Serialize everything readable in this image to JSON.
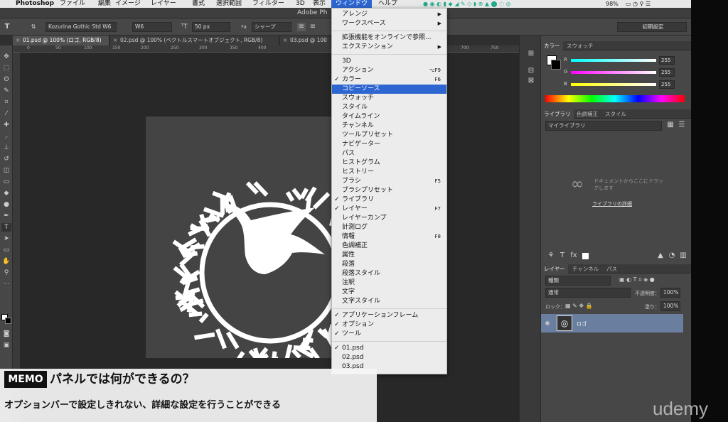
{
  "menubar": {
    "apple": "",
    "app": "Photoshop",
    "items": [
      "ファイル",
      "編集",
      "イメージ",
      "レイヤー",
      "書式",
      "選択範囲",
      "フィルター",
      "3D",
      "表示"
    ],
    "active": "ウィンドウ",
    "help": "ヘルプ",
    "battery": "98%"
  },
  "window_title": "Adobe Ph",
  "options_bar": {
    "font_family": "Kozurina Gothic Std W6",
    "font_style": "W6",
    "font_size": "50 px",
    "aa_label": "ªa",
    "antialias": "シャープ",
    "workspace": "初期設定"
  },
  "doc_tabs": [
    {
      "label": "01.psd @ 100% (ロゴ, RGB/8)",
      "active": true
    },
    {
      "label": "02.psd @ 100% (ベクトルスマートオブジェクト, RGB/8)",
      "active": false
    },
    {
      "label": "03.psd @ 100",
      "active": false
    }
  ],
  "ruler_ticks": [
    "0",
    "50",
    "100",
    "150",
    "200",
    "250",
    "300",
    "350",
    "400",
    "700",
    "750"
  ],
  "window_menu": {
    "items": [
      {
        "label": "アレンジ",
        "submenu": true
      },
      {
        "label": "ワークスペース",
        "submenu": true
      },
      {
        "sep": true
      },
      {
        "label": "拡張機能をオンラインで参照..."
      },
      {
        "label": "エクステンション",
        "submenu": true
      },
      {
        "sep": true
      },
      {
        "label": "3D"
      },
      {
        "label": "アクション",
        "shortcut": "⌥F9"
      },
      {
        "label": "カラー",
        "checked": true,
        "shortcut": "F6"
      },
      {
        "label": "コピーソース",
        "highlight": true
      },
      {
        "label": "スウォッチ"
      },
      {
        "label": "スタイル"
      },
      {
        "label": "タイムライン"
      },
      {
        "label": "チャンネル"
      },
      {
        "label": "ツールプリセット"
      },
      {
        "label": "ナビゲーター"
      },
      {
        "label": "パス"
      },
      {
        "label": "ヒストグラム"
      },
      {
        "label": "ヒストリー"
      },
      {
        "label": "ブラシ",
        "shortcut": "F5"
      },
      {
        "label": "ブラシプリセット"
      },
      {
        "label": "ライブラリ",
        "checked": true
      },
      {
        "label": "レイヤー",
        "checked": true,
        "shortcut": "F7"
      },
      {
        "label": "レイヤーカンプ"
      },
      {
        "label": "計測ログ"
      },
      {
        "label": "情報",
        "shortcut": "F8"
      },
      {
        "label": "色調補正"
      },
      {
        "label": "属性"
      },
      {
        "label": "段落"
      },
      {
        "label": "段落スタイル"
      },
      {
        "label": "注釈"
      },
      {
        "label": "文字"
      },
      {
        "label": "文字スタイル"
      },
      {
        "sep": true
      },
      {
        "label": "アプリケーションフレーム",
        "checked": true
      },
      {
        "label": "オプション",
        "checked": true
      },
      {
        "label": "ツール",
        "checked": true
      },
      {
        "sep": true
      },
      {
        "label": "01.psd",
        "checked": true
      },
      {
        "label": "02.psd"
      },
      {
        "label": "03.psd"
      }
    ]
  },
  "color_panel": {
    "tabs": [
      "カラー",
      "スウォッチ"
    ],
    "r": "255",
    "g": "255",
    "b": "255",
    "r_label": "R",
    "g_label": "G",
    "b_label": "B"
  },
  "library_panel": {
    "tabs": [
      "ライブラリ",
      "色調補正",
      "スタイル"
    ],
    "selector": "マイライブラリ",
    "drop_hint": "ドキュメントからここにドラッグします",
    "link": "ライブラリの詳細"
  },
  "layers_panel": {
    "tabs": [
      "レイヤー",
      "チャンネル",
      "パス"
    ],
    "kind": "種類",
    "blend": "通常",
    "opacity_label": "不透明度：",
    "opacity": "100%",
    "lock_label": "ロック：",
    "fill_label": "塗り：",
    "fill": "100%",
    "layer_name": "ロゴ"
  },
  "memo": {
    "badge": "MEMO",
    "title": "パネルでは何ができるの？",
    "subtitle": "オプションバーで設定しきれない、詳細な設定を行うことができる"
  },
  "watermark": "udemy",
  "colors": {
    "accent": "#2d66d1",
    "panel": "#474747",
    "canvas": "#282828"
  }
}
